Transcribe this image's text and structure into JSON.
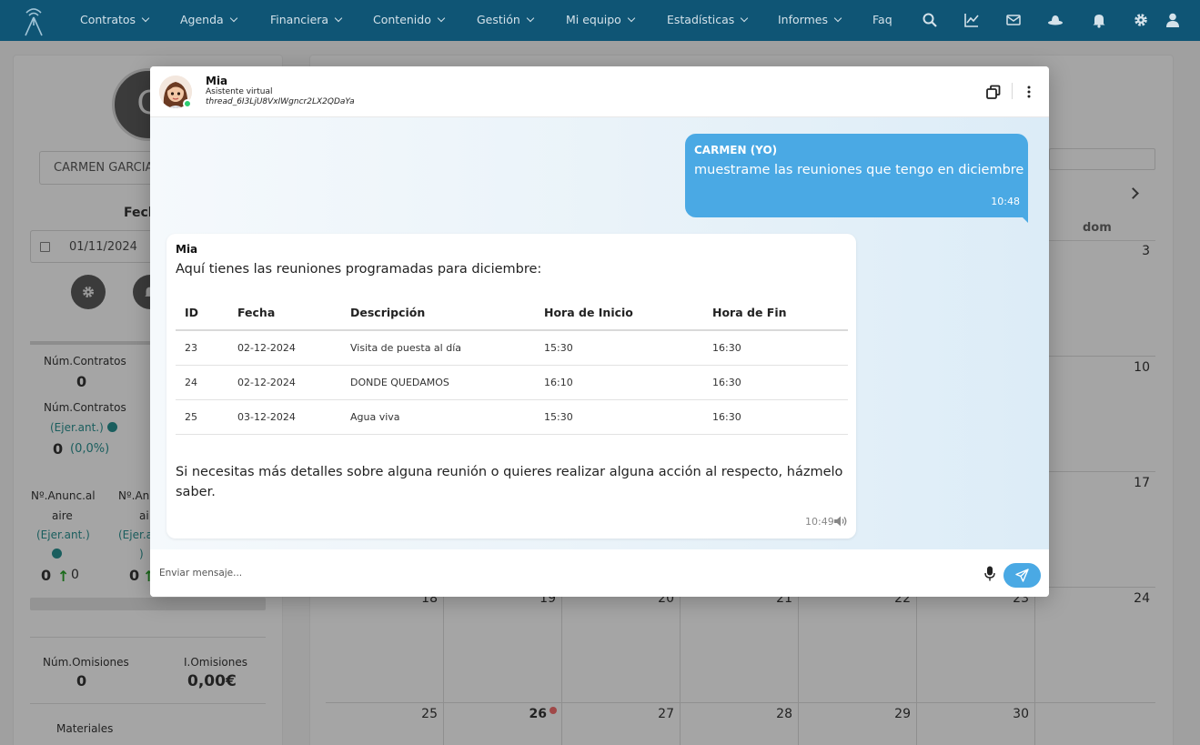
{
  "nav": {
    "items": [
      {
        "label": "Contratos",
        "caret": true
      },
      {
        "label": "Agenda",
        "caret": true
      },
      {
        "label": "Financiera",
        "caret": true
      },
      {
        "label": "Contenido",
        "caret": true
      },
      {
        "label": "Gestión",
        "caret": true
      },
      {
        "label": "Mi equipo",
        "caret": true
      },
      {
        "label": "Estadísticas",
        "caret": true
      },
      {
        "label": "Informes",
        "caret": true
      },
      {
        "label": "Faq",
        "caret": false
      }
    ],
    "icons": [
      "search-icon",
      "chart-icon",
      "mail-icon",
      "hat-icon",
      "bell-icon",
      "gear-icon",
      "user-icon"
    ],
    "color": "#0f5575"
  },
  "background": {
    "avatar_letter": "C",
    "user_name": "CARMEN GARCIA",
    "date_label": "Fech",
    "date_from": "01/11/2024",
    "date_sep": "-",
    "stats": {
      "contratos_label": "Núm.Contratos",
      "contratos_value": "0",
      "contratos_prev_label": "Núm.Contratos",
      "ejer_ant": "(Ejer.ant.)",
      "contratos_prev_value": "0",
      "contratos_prev_pct": "(0,0%)",
      "anunc_label_1": "Nº.Anunc.al",
      "anunc_label_2": "aire",
      "anunc2_label_1": "Nº.Anu",
      "anunc2_label_2": "ai",
      "ejer_ant_2": "(Ejer.a",
      "ejer_ant_2b": ")",
      "anunc_value": "0",
      "anunc_prev_value": "0",
      "anunc2_value": "0",
      "omisiones_label": "Núm.Omisiones",
      "omisiones_value": "0",
      "i_omisiones_label": "I.Omisiones",
      "i_omisiones_value": "0,00€",
      "materiales_label": "Materiales"
    },
    "calendar": {
      "dom_label": "dom",
      "days": [
        "3",
        "10",
        "17",
        "18",
        "19",
        "20",
        "21",
        "22",
        "23",
        "24",
        "25",
        "26",
        "27",
        "28",
        "29",
        "30"
      ],
      "today": "26"
    }
  },
  "chat": {
    "bot": {
      "name": "Mia",
      "subtitle": "Asistente virtual",
      "thread": "thread_6I3LjU8VxIWgncr2LX2QDaYa"
    },
    "messages": [
      {
        "sender": "CARMEN (YO)",
        "text": "muestrame las reuniones que tengo en diciembre",
        "time": "10:48"
      },
      {
        "sender": "Mia",
        "intro": "Aquí tienes las reuniones programadas para diciembre:",
        "table": {
          "headers": [
            "ID",
            "Fecha",
            "Descripción",
            "Hora de Inicio",
            "Hora de Fin"
          ],
          "rows": [
            [
              "23",
              "02-12-2024",
              "Visita de puesta al día",
              "15:30",
              "16:30"
            ],
            [
              "24",
              "02-12-2024",
              "DONDE QUEDAMOS",
              "16:10",
              "16:30"
            ],
            [
              "25",
              "03-12-2024",
              "Agua viva",
              "15:30",
              "16:30"
            ]
          ]
        },
        "outro": "Si necesitas más detalles sobre alguna reunión o quieres realizar alguna acción al respecto, házmelo saber.",
        "time": "10:49"
      }
    ],
    "input_placeholder": "Enviar mensaje...",
    "accent_color": "#4aa9e4"
  }
}
